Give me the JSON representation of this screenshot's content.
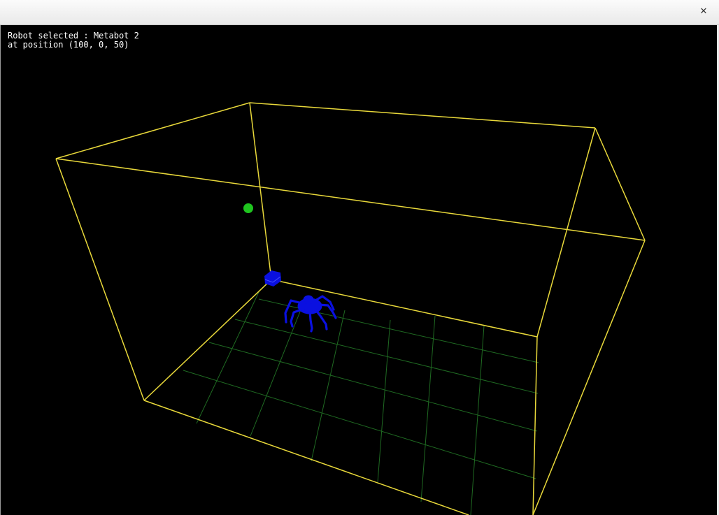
{
  "window": {
    "close_icon": "close-icon"
  },
  "overlay": {
    "robot_selected_line": "Robot selected : Metabot 2",
    "position_line": "at position (100, 0, 50)"
  },
  "scene": {
    "box_color": "#e8d83a",
    "grid_color": "#1f6a22",
    "robot_color": "#0a10e0",
    "target_color": "#1fc41f",
    "background_color": "#000000"
  }
}
